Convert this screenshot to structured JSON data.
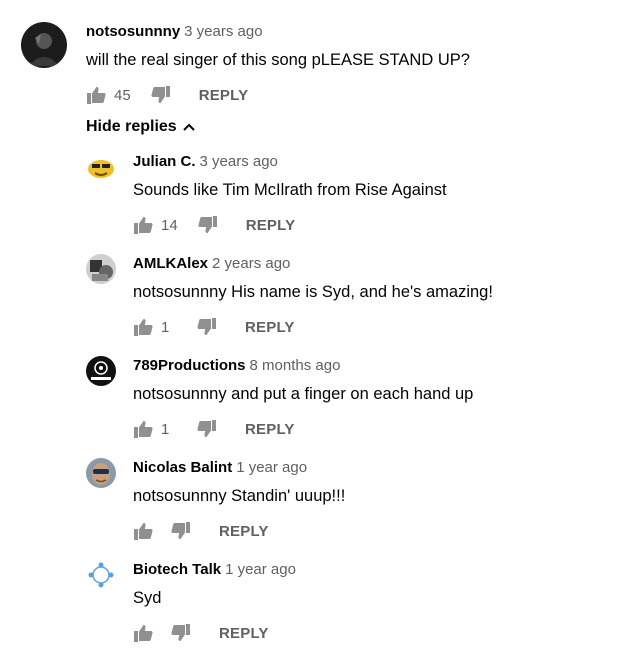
{
  "top_comment": {
    "author": "notsosunnny",
    "time": "3 years ago",
    "text": "will the real singer of this song pLEASE STAND UP?",
    "likes": "45",
    "reply_label": "REPLY"
  },
  "hide_replies_label": "Hide replies",
  "replies": [
    {
      "author": "Julian C.",
      "time": "3 years ago",
      "text": "Sounds like Tim McIlrath from Rise Against",
      "likes": "14",
      "reply_label": "REPLY"
    },
    {
      "author": "AMLKAlex",
      "time": "2 years ago",
      "text": "notsosunnny His name is Syd, and he's amazing!",
      "likes": "1",
      "reply_label": "REPLY"
    },
    {
      "author": "789Productions",
      "time": "8 months ago",
      "text": "notsosunnny and put a finger on each hand up",
      "likes": "1",
      "reply_label": "REPLY"
    },
    {
      "author": "Nicolas Balint",
      "time": "1 year ago",
      "text": "notsosunnny Standin' uuup!!!",
      "likes": "",
      "reply_label": "REPLY"
    },
    {
      "author": "Biotech Talk",
      "time": "1 year ago",
      "text": "Syd",
      "likes": "",
      "reply_label": "REPLY"
    }
  ],
  "icons": {
    "like": "thumbs-up-icon",
    "dislike": "thumbs-down-icon",
    "collapse": "chevron-up-icon"
  },
  "colors": {
    "text": "#030303",
    "secondary": "#606060",
    "icon": "#909090"
  }
}
